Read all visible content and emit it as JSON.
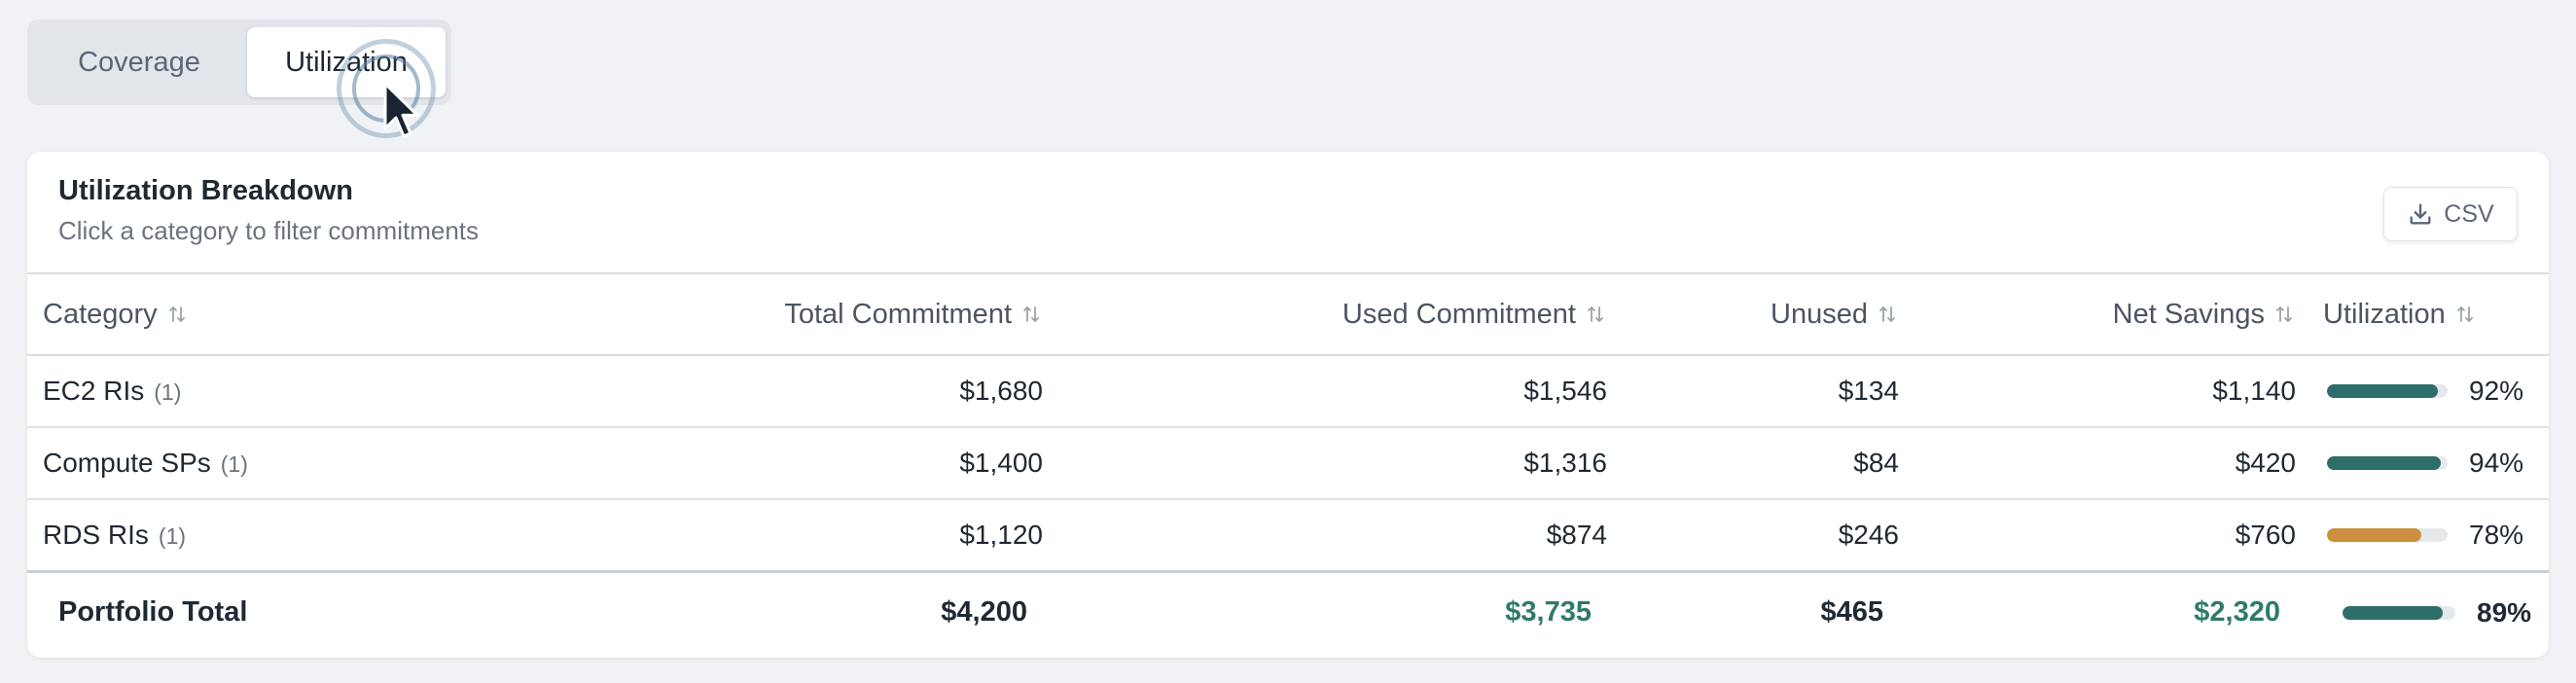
{
  "tabs": [
    {
      "label": "Coverage",
      "active": false
    },
    {
      "label": "Utilization",
      "active": true
    }
  ],
  "card": {
    "title": "Utilization Breakdown",
    "subtitle": "Click a category to filter commitments",
    "csv_label": "CSV"
  },
  "table": {
    "headers": [
      "Category",
      "Total Commitment",
      "Used Commitment",
      "Unused",
      "Net Savings",
      "Utilization"
    ],
    "rows": [
      {
        "category": "EC2 RIs",
        "count": "(1)",
        "total": "$1,680",
        "used": "$1,546",
        "unused": "$134",
        "savings": "$1,140",
        "util_pct": "92%",
        "util_value": 0.92,
        "bar_color": "#2e6e6a"
      },
      {
        "category": "Compute SPs",
        "count": "(1)",
        "total": "$1,400",
        "used": "$1,316",
        "unused": "$84",
        "savings": "$420",
        "util_pct": "94%",
        "util_value": 0.94,
        "bar_color": "#2e6e6a"
      },
      {
        "category": "RDS RIs",
        "count": "(1)",
        "total": "$1,120",
        "used": "$874",
        "unused": "$246",
        "savings": "$760",
        "util_pct": "78%",
        "util_value": 0.78,
        "bar_color": "#cc8f3e"
      }
    ],
    "footer": {
      "label": "Portfolio Total",
      "total": "$4,200",
      "used": "$3,735",
      "unused": "$465",
      "savings": "$2,320",
      "util_pct": "89%",
      "util_value": 0.89,
      "bar_color": "#2e6e6a"
    }
  },
  "colors": {
    "accent_green": "#2e7a6c",
    "bar_teal": "#2e6e6a",
    "bar_amber": "#cc8f3e"
  }
}
